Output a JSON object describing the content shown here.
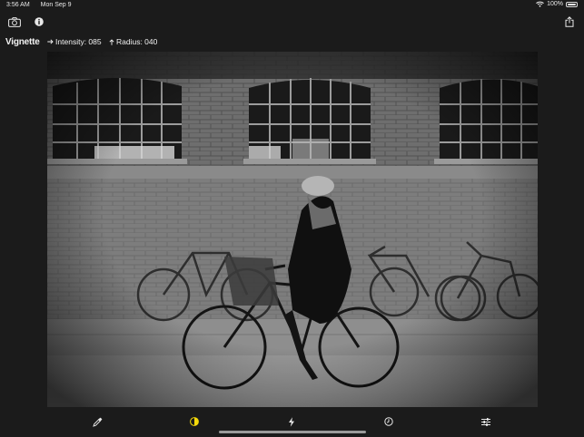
{
  "status_bar": {
    "time": "3:56 AM",
    "date": "Mon Sep 9",
    "battery_text": "100%",
    "battery_level": 1.0,
    "icons": [
      "wifi-icon",
      "battery-icon"
    ]
  },
  "toolbar": {
    "left_icons": [
      "camera-icon",
      "info-icon"
    ],
    "right_icons": [
      "share-icon"
    ]
  },
  "adjustment": {
    "mode": "Vignette",
    "intensity_label": "Intensity: 085",
    "radius_label": "Radius: 040",
    "intensity_icon": "arrow-right-icon",
    "radius_icon": "arrow-up-icon"
  },
  "photo": {
    "description_icon": "photo"
  },
  "bottom_tools": [
    {
      "icon": "eyedropper-icon",
      "selected": false
    },
    {
      "icon": "contrast-icon",
      "selected": true
    },
    {
      "icon": "lightning-icon",
      "selected": false
    },
    {
      "icon": "clock-icon",
      "selected": false
    },
    {
      "icon": "sliders-icon",
      "selected": false
    }
  ],
  "colors": {
    "background": "#1b1b1b",
    "accent": "#f5d90a",
    "text": "#ffffff"
  }
}
